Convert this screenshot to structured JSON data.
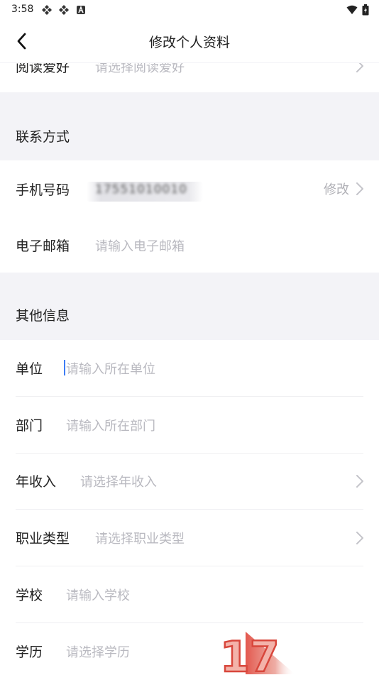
{
  "status_bar": {
    "time": "3:58",
    "icons_left": [
      "app-icon",
      "app-icon",
      "notification-icon"
    ],
    "icons_right": [
      "wifi-icon",
      "battery-icon"
    ]
  },
  "nav": {
    "title": "修改个人资料",
    "back_icon": "chevron-left-icon"
  },
  "partial_row": {
    "label": "阅读爱好",
    "placeholder": "请选择阅读爱好"
  },
  "contact_section": {
    "title": "联系方式",
    "phone": {
      "label": "手机号码",
      "value": "17551010010",
      "action_label": "修改"
    },
    "email": {
      "label": "电子邮箱",
      "placeholder": "请输入电子邮箱"
    }
  },
  "other_section": {
    "title": "其他信息",
    "items": [
      {
        "label": "单位",
        "placeholder": "请输入所在单位"
      },
      {
        "label": "部门",
        "placeholder": "请输入所在部门"
      },
      {
        "label": "年收入",
        "placeholder": "请选择年收入"
      },
      {
        "label": "职业类型",
        "placeholder": "请选择职业类型"
      },
      {
        "label": "学校",
        "placeholder": "请输入学校"
      },
      {
        "label": "学历",
        "placeholder": "请选择学历"
      }
    ]
  },
  "colors": {
    "section_bg": "#f3f3f7",
    "placeholder": "#b9b9c0",
    "cursor": "#3d7cf5",
    "watermark": "#e0453a"
  },
  "watermark_text": "17"
}
